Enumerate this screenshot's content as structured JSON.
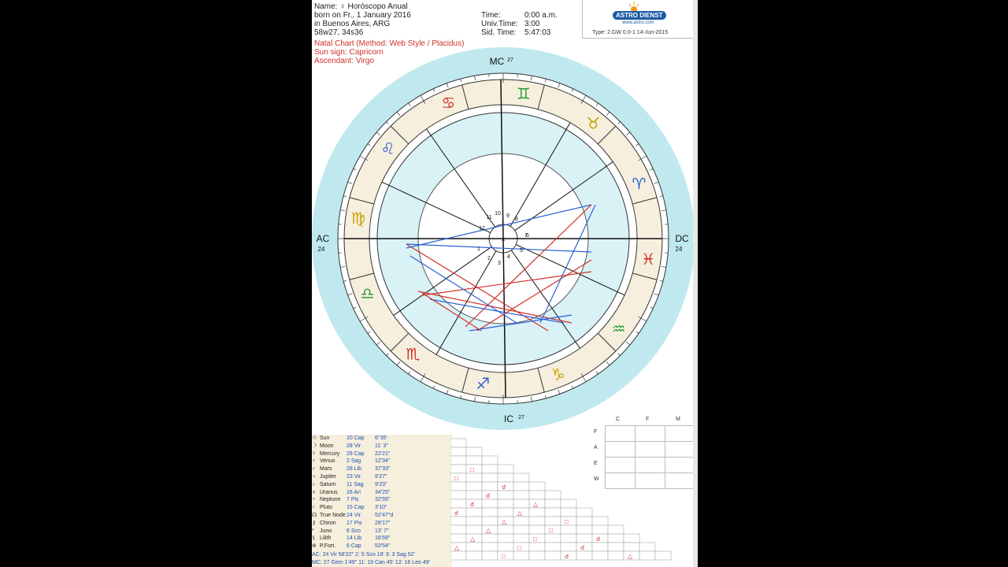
{
  "header": {
    "name_line": "Name:  ♀ Horóscopo Anual",
    "born_line": "born on Fr., 1 January 2016",
    "place_line": "in Buenos Aires, ARG",
    "coords_line": "58w27, 34s36",
    "time_label": "Time:",
    "time_value": "0:00 a.m.",
    "univ_label": "Univ.Time:",
    "univ_value": "3:00",
    "sid_label": "Sid. Time:",
    "sid_value": "5:47:03"
  },
  "logo": {
    "brand": "ASTRO DIENST",
    "url": "www.astro.com",
    "type_line": "Type: 2.GW   0.0-1  14-Jun-2015"
  },
  "chart_info": {
    "method": "Natal Chart  (Method: Web Style / Placidus)",
    "sun_sign": "Sun sign: Capricorn",
    "ascendant": "Ascendant: Virgo"
  },
  "wheel": {
    "mc": "MC",
    "mc_deg": "27",
    "ic": "IC",
    "ic_deg": "27",
    "ac": "AC",
    "ac_deg": "24",
    "dc": "DC",
    "dc_deg": "24",
    "houses": [
      "1",
      "2",
      "3",
      "4",
      "5",
      "6",
      "7",
      "8",
      "9",
      "10",
      "11",
      "12"
    ],
    "center": "×",
    "signs": [
      "♋",
      "♊",
      "♉",
      "♈",
      "♓",
      "♒",
      "♑",
      "♐",
      "♏",
      "♎",
      "♍",
      "♌"
    ],
    "colors": {
      "ring": "#bfe9ee",
      "band": "#f6efdd",
      "inner": "#d9f2f5",
      "red": "#d0302a",
      "blue": "#2c61d6"
    }
  },
  "planets": [
    {
      "glyph": "☉",
      "name": "Sun",
      "sign": "10 Cap",
      "pos": "6°35'"
    },
    {
      "glyph": "☽",
      "name": "Moon",
      "sign": "28 Vir",
      "pos": "11' 3\""
    },
    {
      "glyph": "☿",
      "name": "Mercury",
      "sign": "29 Cap",
      "pos": "22'21\""
    },
    {
      "glyph": "♀",
      "name": "Venus",
      "sign": "2 Sag",
      "pos": "12'34\""
    },
    {
      "glyph": "♂",
      "name": "Mars",
      "sign": "28 Lib",
      "pos": "37'33\""
    },
    {
      "glyph": "♃",
      "name": "Jupiter",
      "sign": "23 Vir",
      "pos": "9'27\""
    },
    {
      "glyph": "♄",
      "name": "Saturn",
      "sign": "11 Sag",
      "pos": "9'23\""
    },
    {
      "glyph": "♅",
      "name": "Uranus",
      "sign": "16 Ari",
      "pos": "34'25\""
    },
    {
      "glyph": "♆",
      "name": "Neptune",
      "sign": "7 Pis",
      "pos": "32'55\""
    },
    {
      "glyph": "♇",
      "name": "Pluto",
      "sign": "15 Cap",
      "pos": "3'10\""
    },
    {
      "glyph": "☊",
      "name": "True Node",
      "sign": "24 Vir",
      "pos": "52'47\"d"
    },
    {
      "glyph": "⚷",
      "name": "Chiron",
      "sign": "17 Pis",
      "pos": "28'17\""
    },
    {
      "glyph": "*",
      "name": "Juno",
      "sign": "6 Sco",
      "pos": "13' 7\""
    },
    {
      "glyph": "⚸",
      "name": "Lilith",
      "sign": "14 Lib",
      "pos": "16'59\""
    },
    {
      "glyph": "⊕",
      "name": "P.Fort.",
      "sign": "6 Cap",
      "pos": "53'54\""
    }
  ],
  "house_rows": [
    "AC: 24  Vir 58'22\"   2:  5 Sco 18'   3:  3 Sag 52'",
    "MC: 27 Gem 1'49\"  11: 19 Can 45'  12: 16 Leo 49'"
  ],
  "cfm": {
    "c": "C",
    "f": "F",
    "m": "M",
    "fire": "F",
    "air": "A",
    "earth": "E",
    "water": "W"
  }
}
